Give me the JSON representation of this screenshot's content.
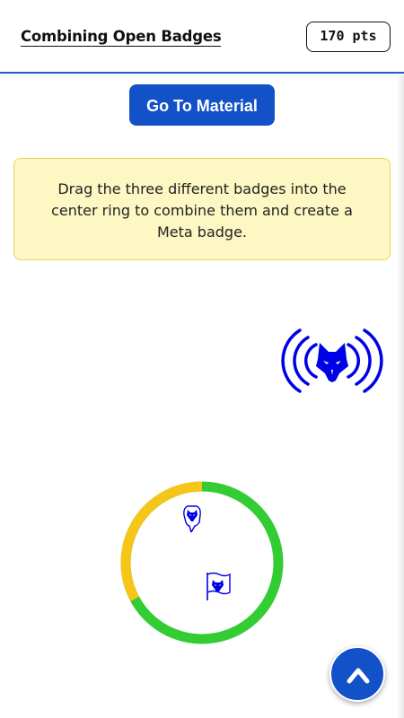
{
  "header": {
    "title": "Combining Open Badges",
    "points": "170 pts"
  },
  "actions": {
    "go_to_material": "Go To Material"
  },
  "instructions": {
    "text": "Drag the three different badges into the center ring to combine them and create a Meta badge."
  },
  "ring": {
    "progress_green_fraction": 0.8,
    "progress_yellow_fraction": 0.2
  },
  "badges": {
    "draggable_icon": "wolf-broadcast-badge-icon",
    "in_ring": [
      "wolf-hand-badge-icon",
      "wolf-flag-badge-icon"
    ]
  },
  "colors": {
    "primary_blue": "#1351c9",
    "badge_blue": "#0000e6",
    "ring_green": "#33cc33",
    "ring_yellow": "#f5c518",
    "instruction_bg": "#fdf7c3"
  },
  "fab": {
    "icon": "chevron-up-icon"
  }
}
